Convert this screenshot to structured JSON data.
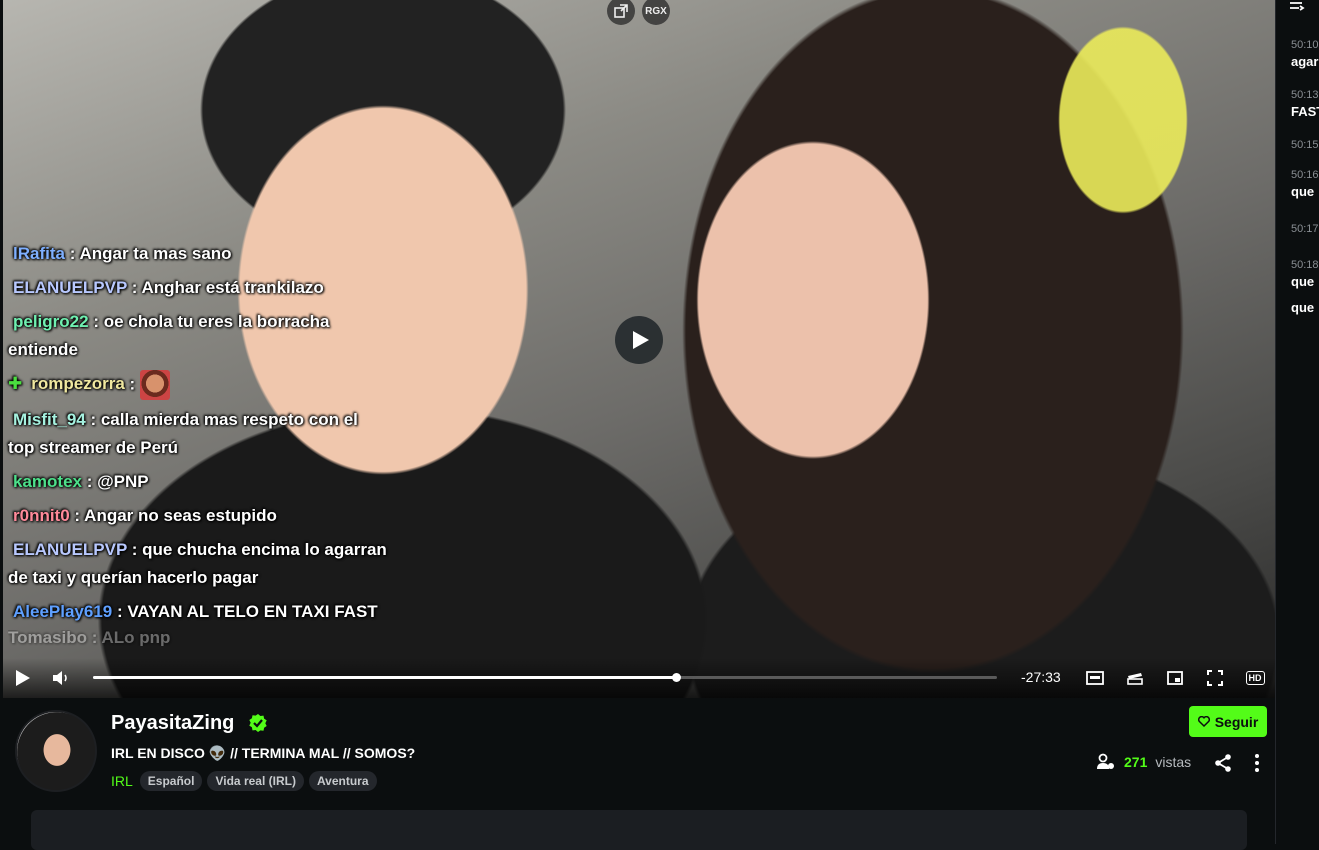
{
  "player": {
    "rgx_label": "RGX",
    "time_remaining": "-27:33",
    "progress_fraction": 0.645,
    "hd_label": "HD"
  },
  "overlay_chat": [
    {
      "user": "lRafita",
      "color": "#7fb0ff",
      "text": " : Angar ta mas sano"
    },
    {
      "user": "ELANUELPVP",
      "color": "#b9c9ff",
      "text": " : Anghar está trankilazo"
    },
    {
      "user": "peligro22",
      "color": "#6ff0b0",
      "text": " : oe chola tu eres la borracha entiende"
    },
    {
      "user": "rompezorra",
      "color": "#f0e8a0",
      "text": " : ",
      "badge": "✚",
      "emote": true
    },
    {
      "user": "Misfit_94",
      "color": "#a6f2e0",
      "text": " : calla mierda mas respeto con el top streamer de Perú"
    },
    {
      "user": "kamotex",
      "color": "#4de08a",
      "text": " : @PNP"
    },
    {
      "user": "r0nnit0",
      "color": "#ff8a9a",
      "text": " : Angar no seas estupido"
    },
    {
      "user": "ELANUELPVP",
      "color": "#b9c9ff",
      "text": " : que chucha encima lo agarran de taxi y querían hacerlo pagar"
    },
    {
      "user": "AleePlay619",
      "color": "#5fa0ff",
      "text": " : VAYAN AL TELO EN TAXI FAST"
    }
  ],
  "overlay_faded_bottom": "Tomasibo : ALo pnp",
  "channel": {
    "name": "PayasitaZing",
    "title_part1": "IRL EN DISCO ",
    "title_emoji": "👽",
    "title_part2": " // TERMINA MAL // SOMOS?",
    "category": "IRL",
    "tags": [
      "Español",
      "Vida real (IRL)",
      "Aventura"
    ],
    "follow_label": "Seguir",
    "viewer_count": "271",
    "viewer_label": "vistas",
    "accent_color": "#53fc18"
  },
  "side_chat": [
    {
      "ts": "50:10",
      "text": "agar"
    },
    {
      "ts": "50:13",
      "text": "FAST"
    },
    {
      "ts": "50:15",
      "text": ""
    },
    {
      "ts": "50:16",
      "text": "que"
    },
    {
      "ts": "50:17",
      "text": ""
    },
    {
      "ts": "50:18",
      "text": "que"
    },
    {
      "ts": "",
      "text": "que"
    }
  ]
}
